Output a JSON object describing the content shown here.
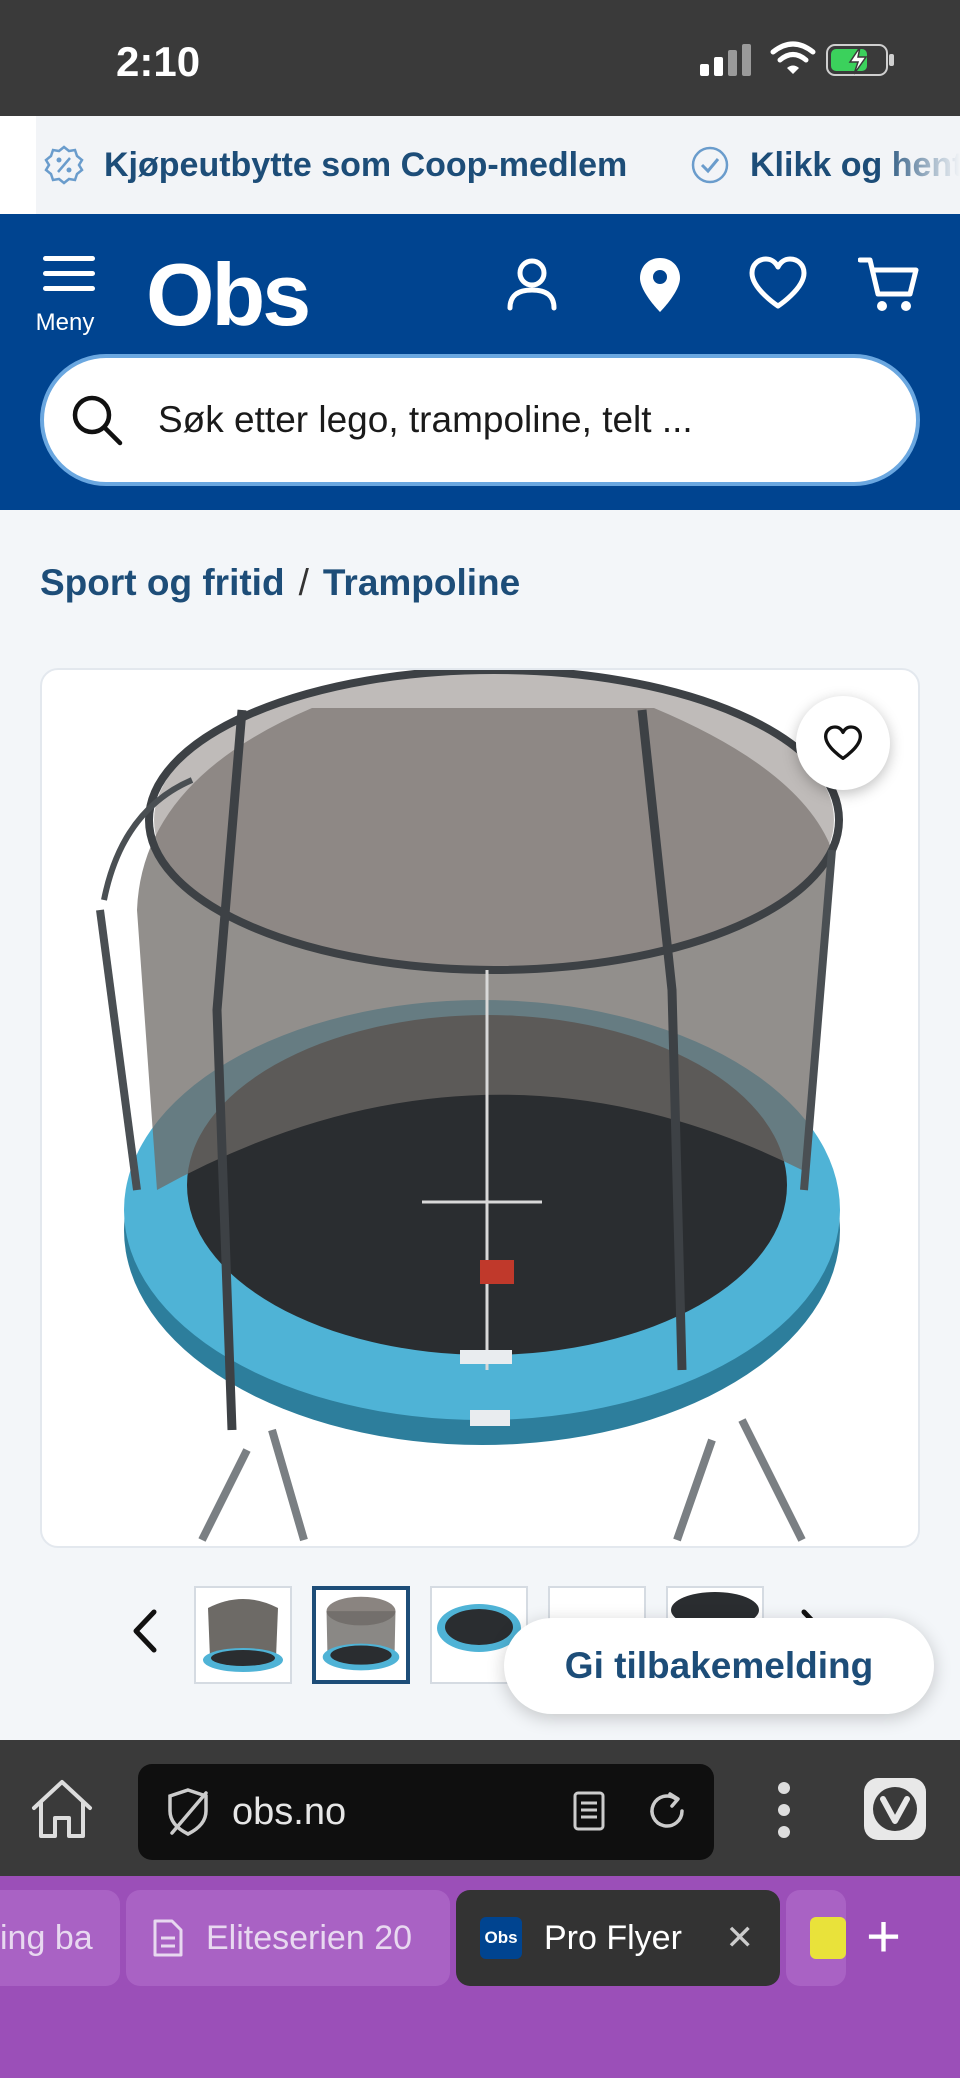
{
  "status_bar": {
    "time": "2:10"
  },
  "promo": [
    {
      "label": "Kjøpeutbytte som Coop-medlem",
      "icon": "percent-badge-icon"
    },
    {
      "label": "Klikk og hent",
      "icon": "check-circle-icon"
    }
  ],
  "header": {
    "brand": "Obs",
    "menu_label": "Meny",
    "icons": [
      "account-icon",
      "store-location-icon",
      "favorites-icon",
      "cart-icon"
    ],
    "search_placeholder": "Søk etter lego, trampoline, telt ..."
  },
  "breadcrumb": {
    "items": [
      "Sport og fritid",
      "Trampoline"
    ],
    "separator": "/"
  },
  "product": {
    "image_alt": "Trampoline med sikkerhetsnett",
    "thumbnails_count": 5,
    "active_thumbnail": 2
  },
  "feedback": {
    "label": "Gi tilbakemelding"
  },
  "browser": {
    "url": "obs.no"
  },
  "tabs": [
    {
      "label": "ing ba",
      "active": false
    },
    {
      "label": "Eliteserien 20",
      "active": false
    },
    {
      "label": "Pro Flyer",
      "active": true
    },
    {
      "label": "",
      "active": false
    }
  ],
  "colors": {
    "brand_blue": "#004490",
    "text_blue": "#1d4d78",
    "tab_bar": "#9b4fb8",
    "trampoline_pad": "#4fb3d6"
  }
}
